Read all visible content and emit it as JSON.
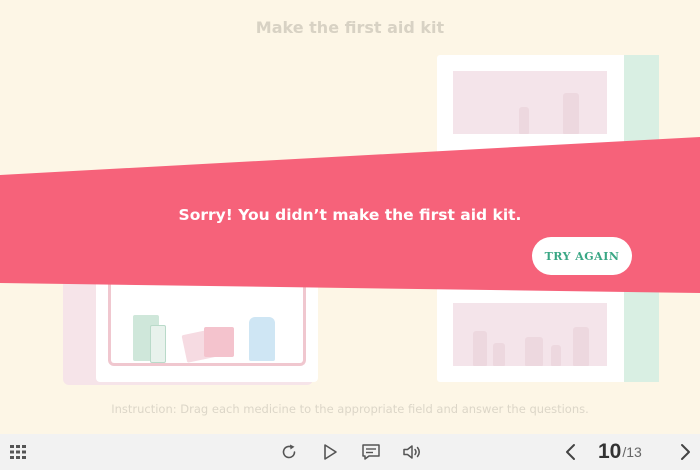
{
  "slide": {
    "title": "Make the first aid kit",
    "instruction": "Instruction: Drag each medicine to the appropriate field and answer the questions."
  },
  "feedback": {
    "message": "Sorry! You didn’t make the first aid kit.",
    "button_label": "TRY AGAIN",
    "banner_color": "#f6627a",
    "button_text_color": "#3aa785"
  },
  "player": {
    "icons": [
      "menu-grid-icon",
      "replay-icon",
      "play-icon",
      "comment-icon",
      "volume-icon",
      "chevron-left-icon",
      "chevron-right-icon"
    ],
    "current_page": "10",
    "separator": "/",
    "total_pages": "13"
  }
}
